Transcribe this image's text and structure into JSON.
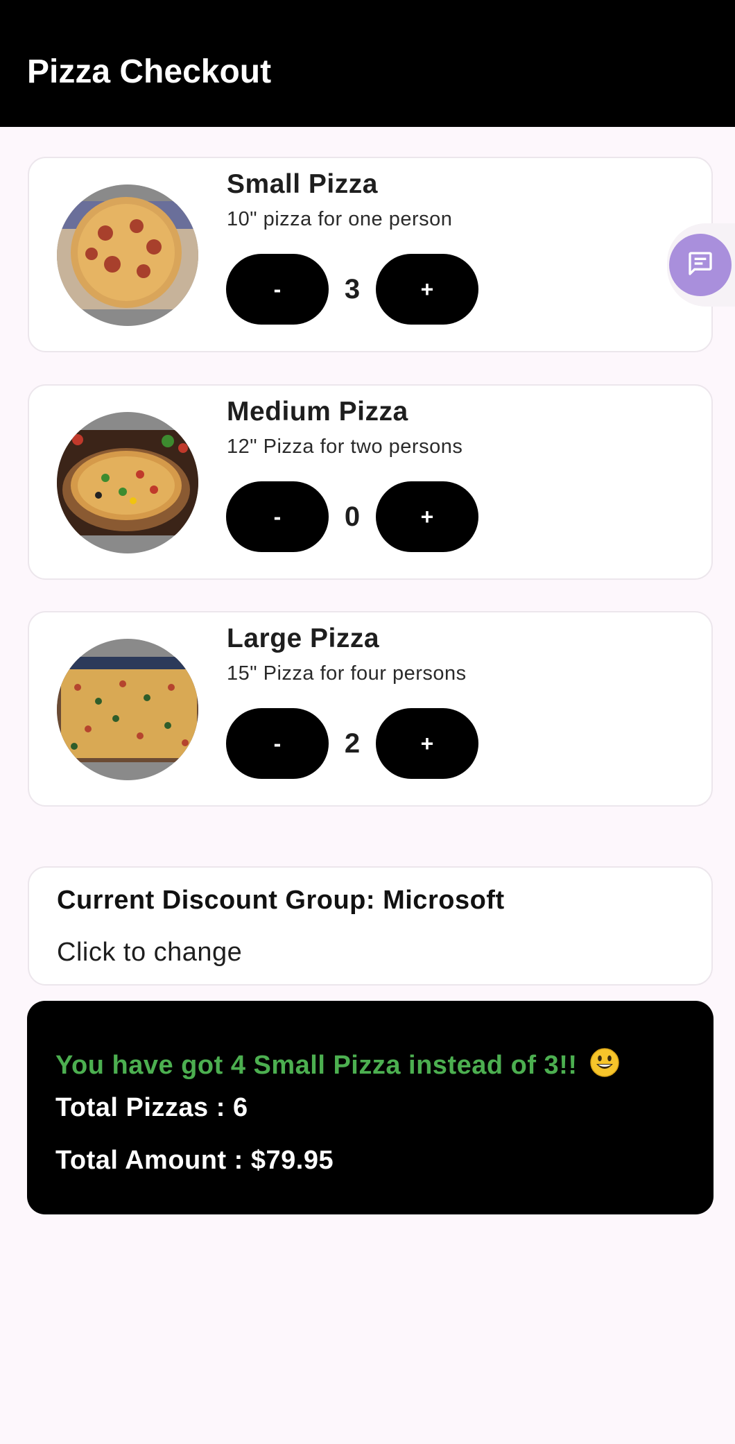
{
  "app_bar": {
    "title": "Pizza Checkout"
  },
  "pizzas": [
    {
      "name": "Small Pizza",
      "description": "10\" pizza for one person",
      "quantity": "3",
      "minus_label": "-",
      "plus_label": "+",
      "image": "pepperoni-pizza-photo"
    },
    {
      "name": "Medium Pizza",
      "description": "12\" Pizza for two persons",
      "quantity": "0",
      "minus_label": "-",
      "plus_label": "+",
      "image": "veggie-pizza-photo"
    },
    {
      "name": "Large Pizza",
      "description": "15\" Pizza for four persons",
      "quantity": "2",
      "minus_label": "-",
      "plus_label": "+",
      "image": "large-cheese-pizza-photo"
    }
  ],
  "discount": {
    "title": "Current Discount Group: Microsoft",
    "subtitle": "Click to change"
  },
  "summary": {
    "promo": "You have got 4 Small Pizza instead of 3!!",
    "promo_icon": "smiling-face-icon",
    "total_pizzas": "Total Pizzas : 6",
    "total_amount": "Total Amount : $79.95"
  },
  "fab": {
    "icon": "chat-bubble-icon"
  },
  "colors": {
    "app_bar": "#000000",
    "background": "#fdf7fc",
    "promo_text": "#4caf50",
    "fab": "#a98fdc"
  }
}
